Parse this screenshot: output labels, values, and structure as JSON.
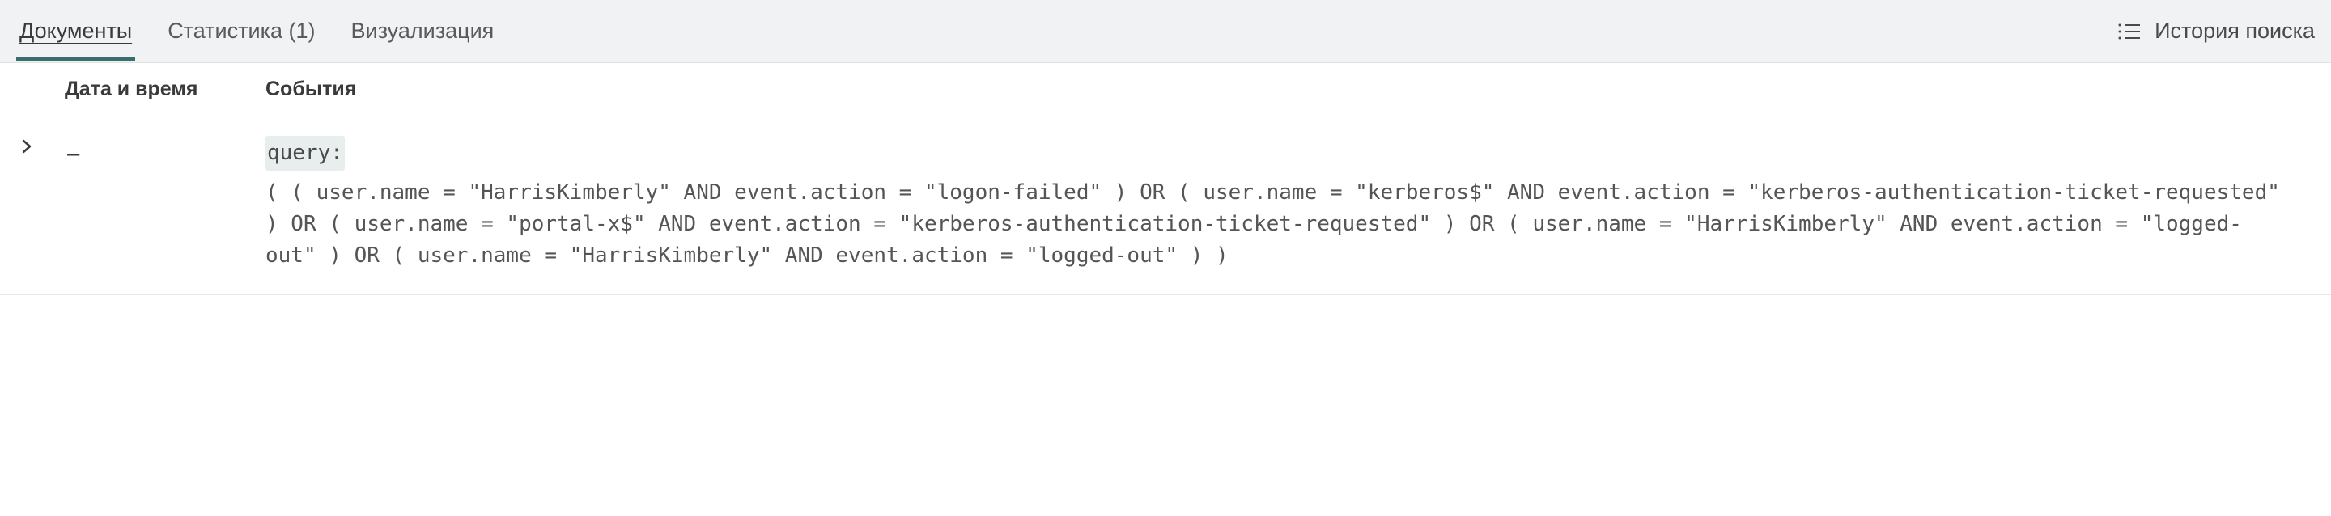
{
  "tabs": {
    "documents": "Документы",
    "statistics": "Статистика (1)",
    "visualization": "Визуализация"
  },
  "history": {
    "label": "История поиска"
  },
  "table": {
    "header_date": "Дата и время",
    "header_events": "События"
  },
  "row": {
    "date": "—",
    "query_label": "query:",
    "query_text": "( ( user.name = \"HarrisKimberly\" AND event.action = \"logon-failed\" ) OR ( user.name = \"kerberos$\" AND event.action = \"kerberos-authentication-ticket-requested\" ) OR ( user.name = \"portal-x$\" AND event.action = \"kerberos-authentication-ticket-requested\" ) OR ( user.name = \"HarrisKimberly\" AND event.action = \"logged-out\" ) OR ( user.name = \"HarrisKimberly\" AND event.action = \"logged-out\" ) )"
  }
}
